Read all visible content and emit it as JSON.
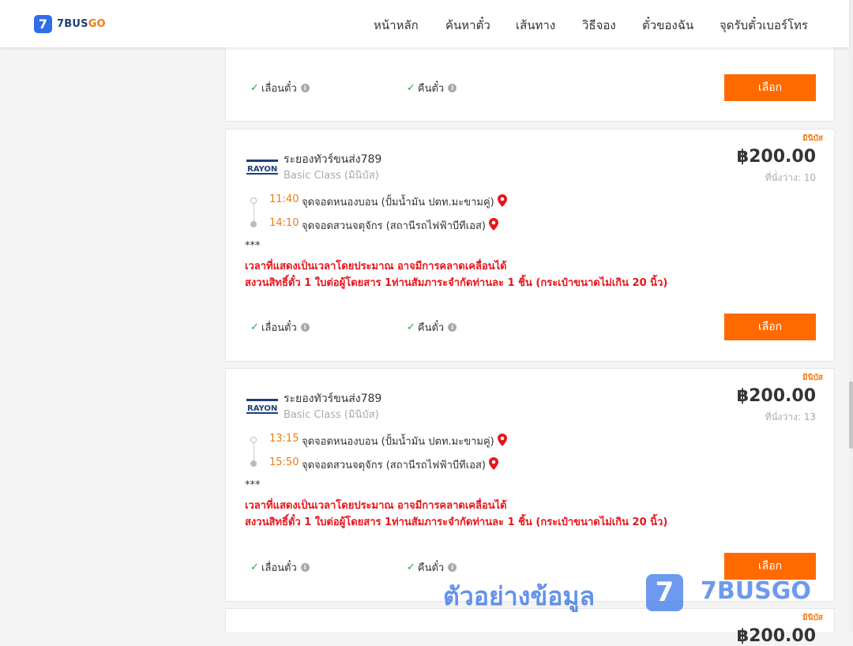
{
  "header": {
    "logo_mark": "7",
    "logo_part1": "7BUS",
    "logo_part2": "GO",
    "nav": [
      "หน้าหลัก",
      "ค้นหาตั๋ว",
      "เส้นทาง",
      "วิธีจอง",
      "ตั๋วของฉัน",
      "จุดรับตั๋วเบอร์โทร"
    ]
  },
  "common": {
    "change_seat": "เลื่อนตั๋ว",
    "refund": "คืนตั๋ว",
    "select": "เลือก",
    "badge": "มินิบัส",
    "op_logo": "RAYONG"
  },
  "trips": [
    {
      "operator": "ระยองทัวร์ขนส่ง789",
      "class": "Basic Class (มินิบัส)",
      "price": "฿200.00",
      "seats": "ที่นั่งว่าง: 10",
      "dep_time": "11:40",
      "dep_stop": "จุดจอดหนองบอน (ปั้มน้ำมัน ปตท.มะขามคู่)",
      "arr_time": "14:10",
      "arr_stop": "จุดจอดสวนจตุจักร (สถานีรถไฟฟ้าบีทีเอส)",
      "note_stars": "***",
      "note_1": "เวลาที่แสดงเป็นเวลาโดยประมาณ อาจมีการคลาดเคลื่อนได้",
      "note_2": "สงวนสิทธิ์ตั๋ว 1 ใบต่อผู้โดยสาร 1ท่านสัมภาระจำกัดท่านละ 1 ชิ้น (กระเป๋าขนาดไม่เกิน 20 นิ้ว)"
    },
    {
      "operator": "ระยองทัวร์ขนส่ง789",
      "class": "Basic Class (มินิบัส)",
      "price": "฿200.00",
      "seats": "ที่นั่งว่าง: 13",
      "dep_time": "13:15",
      "dep_stop": "จุดจอดหนองบอน (ปั้มน้ำมัน ปตท.มะขามคู่)",
      "arr_time": "15:50",
      "arr_stop": "จุดจอดสวนจตุจักร (สถานีรถไฟฟ้าบีทีเอส)",
      "note_stars": "***",
      "note_1": "เวลาที่แสดงเป็นเวลาโดยประมาณ อาจมีการคลาดเคลื่อนได้",
      "note_2": "สงวนสิทธิ์ตั๋ว 1 ใบต่อผู้โดยสาร 1ท่านสัมภาระจำกัดท่านละ 1 ชิ้น (กระเป๋าขนาดไม่เกิน 20 นิ้ว)"
    }
  ],
  "partial_card": {
    "badge": "มินิบัส",
    "price": "฿200.00"
  },
  "watermark": {
    "text": "ตัวอย่างข้อมูล",
    "mark": "7",
    "brand": "7BUSGO"
  }
}
